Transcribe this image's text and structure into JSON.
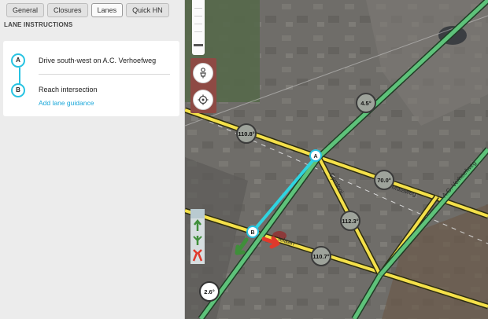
{
  "tabs": [
    {
      "label": "General",
      "active": false
    },
    {
      "label": "Closures",
      "active": false
    },
    {
      "label": "Lanes",
      "active": true
    },
    {
      "label": "Quick HN",
      "active": false
    }
  ],
  "lane_instructions": {
    "title": "LANE INSTRUCTIONS",
    "steps": [
      {
        "marker": "A",
        "text": "Drive south-west on A.C. Verhoefweg"
      },
      {
        "marker": "B",
        "text": "Reach intersection"
      }
    ],
    "add_link": "Add lane guidance"
  },
  "map": {
    "controls": [
      {
        "name": "street-view-icon"
      },
      {
        "name": "locate-icon"
      }
    ],
    "node_markers": [
      "A",
      "B"
    ],
    "angles": [
      "4.5°",
      "110.8°",
      "70.0°",
      "112.3°",
      "110.7°",
      "2.6°"
    ],
    "street_labels": [
      "Symfoni",
      "Mataweg",
      "A.C. Verhoefweg",
      "ielaan"
    ],
    "legend_icons": [
      "straight-arrow-icon",
      "split-arrow-icon",
      "blocked-turn-icon"
    ],
    "colors": {
      "road_green": "#5ec27a",
      "road_yellow": "#f4e04a",
      "node_cyan": "#27c3e2",
      "selected_segment": "#2fd4e0",
      "turn_allowed": "#3f8f3a",
      "turn_blocked": "#e0392b"
    }
  }
}
